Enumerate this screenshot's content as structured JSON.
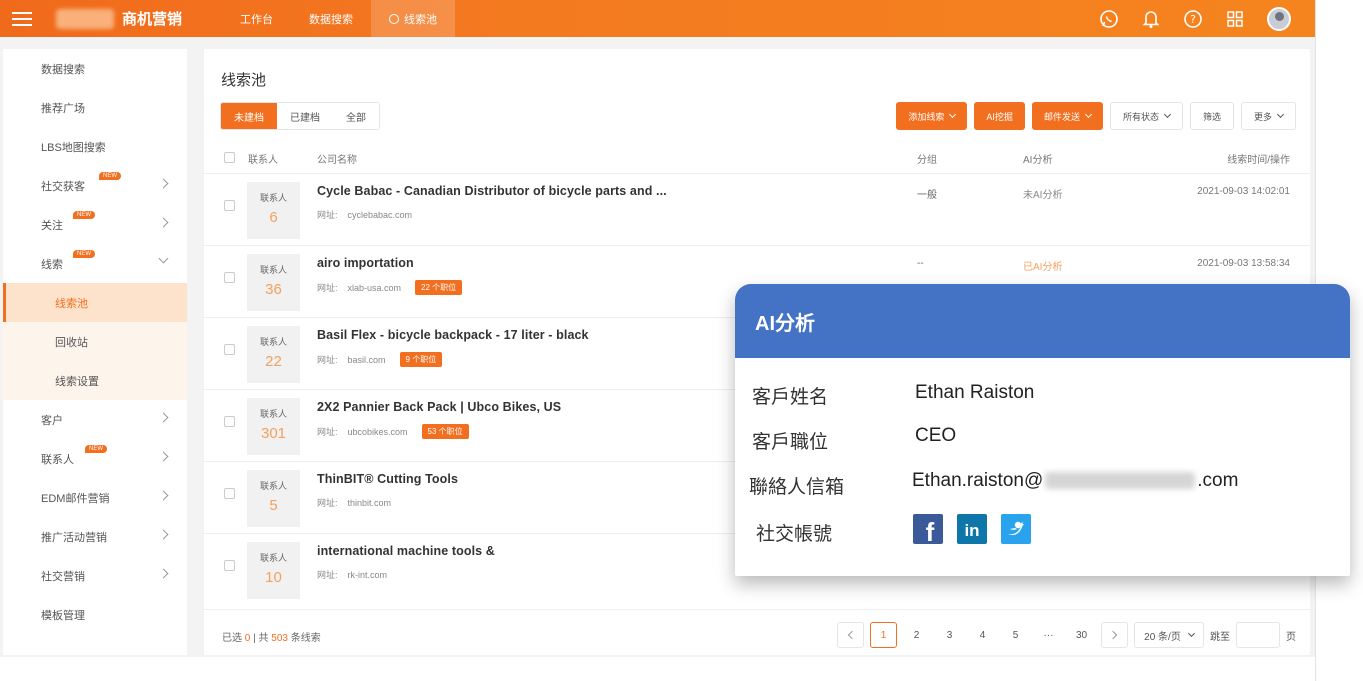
{
  "header": {
    "brand": "商机营销",
    "tabs": [
      {
        "label": "工作台"
      },
      {
        "label": "数据搜索"
      },
      {
        "label": "线索池"
      }
    ]
  },
  "sidebar": {
    "items": [
      {
        "label": "数据搜索"
      },
      {
        "label": "推荐广场"
      },
      {
        "label": "LBS地图搜索"
      },
      {
        "label": "社交获客",
        "badge": "NEW"
      },
      {
        "label": "关注",
        "badge": "NEW"
      },
      {
        "label": "线索",
        "badge": "NEW"
      },
      {
        "label": "线索池"
      },
      {
        "label": "回收站"
      },
      {
        "label": "线索设置"
      },
      {
        "label": "客户"
      },
      {
        "label": "联系人",
        "badge": "NEW"
      },
      {
        "label": "EDM邮件营销"
      },
      {
        "label": "推广活动营销"
      },
      {
        "label": "社交营销"
      },
      {
        "label": "模板管理"
      }
    ]
  },
  "main": {
    "title": "线索池",
    "filters": [
      "未建档",
      "已建档",
      "全部"
    ],
    "actions": {
      "add": "添加线索",
      "ai": "AI挖掘",
      "mail": "邮件发送",
      "status": "所有状态",
      "filter": "筛选",
      "more": "更多"
    },
    "columns": {
      "contact": "联系人",
      "company": "公司名称",
      "group": "分组",
      "ai": "AI分析",
      "time": "线索时间/操作"
    },
    "rows": [
      {
        "contact_label": "联系人",
        "count": "6",
        "name": "Cycle Babac - Canadian Distributor of bicycle parts and ...",
        "url_label": "网址:",
        "url": "cyclebabac.com",
        "jobs": "",
        "group": "一般",
        "ai": "未AI分析",
        "time": "2021-09-03 14:02:01"
      },
      {
        "contact_label": "联系人",
        "count": "36",
        "name": "airo importation",
        "url_label": "网址:",
        "url": "xlab-usa.com",
        "jobs": "22 个职位",
        "group": "--",
        "ai": "已AI分析",
        "time": "2021-09-03 13:58:34"
      },
      {
        "contact_label": "联系人",
        "count": "22",
        "name": "Basil Flex - bicycle backpack - 17 liter - black",
        "url_label": "网址:",
        "url": "basil.com",
        "jobs": "9 个职位",
        "group": "",
        "ai": "",
        "time": ""
      },
      {
        "contact_label": "联系人",
        "count": "301",
        "name": "2X2 Pannier Back Pack | Ubco Bikes, US",
        "url_label": "网址:",
        "url": "ubcobikes.com",
        "jobs": "53 个职位",
        "group": "",
        "ai": "",
        "time": ""
      },
      {
        "contact_label": "联系人",
        "count": "5",
        "name": "ThinBIT® Cutting Tools",
        "url_label": "网址:",
        "url": "thinbit.com",
        "jobs": "",
        "group": "",
        "ai": "",
        "time": ""
      },
      {
        "contact_label": "联系人",
        "count": "10",
        "name": "international machine tools &",
        "url_label": "网址:",
        "url": "rk-int.com",
        "jobs": "",
        "group": "",
        "ai": "",
        "time": ""
      }
    ],
    "footer": {
      "selected_prefix": "已选",
      "selected": "0",
      "total_prefix": "| 共",
      "total": "503",
      "total_suffix": "条线索"
    },
    "pager": {
      "pages": [
        "1",
        "2",
        "3",
        "4",
        "5"
      ],
      "ellipsis": "···",
      "last": "30",
      "size": "20 条/页",
      "jump_label": "跳至",
      "page_suffix": "页"
    }
  },
  "ai_card": {
    "title": "AI分析",
    "name_label": "客戶姓名",
    "name": "Ethan Raiston",
    "position_label": "客戶職位",
    "position": "CEO",
    "email_label": "聯絡人信箱",
    "email_prefix": "Ethan.raiston@",
    "email_suffix": ".com",
    "social_label": "社交帳號",
    "socials": [
      "facebook-icon",
      "linkedin-icon",
      "twitter-icon"
    ]
  },
  "colors": {
    "accent": "#f26f1f",
    "ai_header": "#4472c4"
  }
}
